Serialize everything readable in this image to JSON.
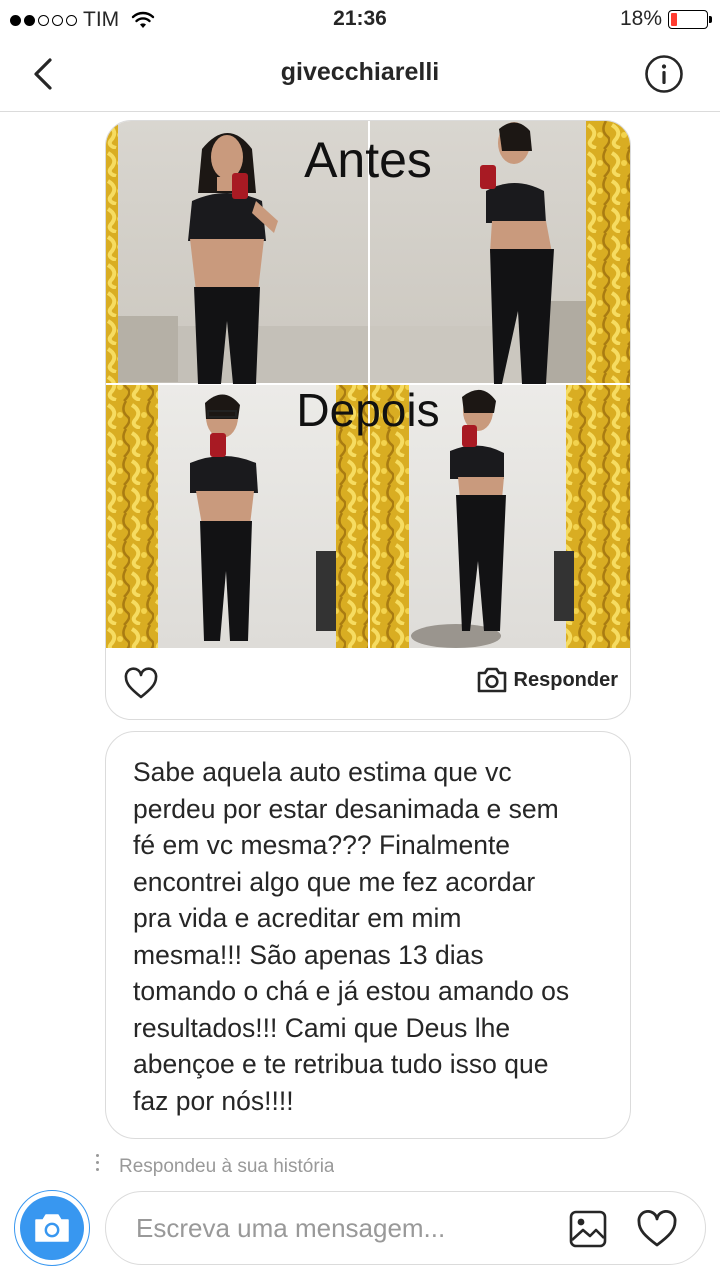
{
  "status_bar": {
    "carrier": "TIM",
    "signal_bars_filled": 2,
    "signal_bars_total": 5,
    "time": "21:36",
    "battery_percent": "18%",
    "battery_level": 0.18
  },
  "header": {
    "title": "givecchiarelli",
    "back_icon": "chevron-left-icon",
    "info_icon": "info-circle-icon"
  },
  "story_card": {
    "before_label": "Antes",
    "after_label": "Depois",
    "like_icon": "heart-outline-icon",
    "reply_icon": "camera-icon",
    "reply_label": "Responder"
  },
  "message": {
    "text": "Sabe aquela auto estima que vc\nperdeu por estar desanimada e sem\nfé em vc mesma??? Finalmente\nencontrei algo que me fez acordar\npra vida e acreditar em mim\nmesma!!! São apenas 13 dias\ntomando o chá e já estou amando os\nresultados!!! Cami que Deus lhe\nabençoe e te retribua tudo isso que\nfaz por nós!!!!"
  },
  "replied_label": "Respondeu à sua história",
  "composer": {
    "placeholder": "Escreva uma mensagem...",
    "camera_icon": "camera-icon",
    "gallery_icon": "image-icon",
    "heart_icon": "heart-outline-icon"
  },
  "colors": {
    "accent": "#3897f0",
    "border": "#dbdbdb",
    "text": "#262626",
    "muted": "#999999",
    "battery_low": "#ff3b30",
    "mirror_frame": "#e0b92a"
  }
}
